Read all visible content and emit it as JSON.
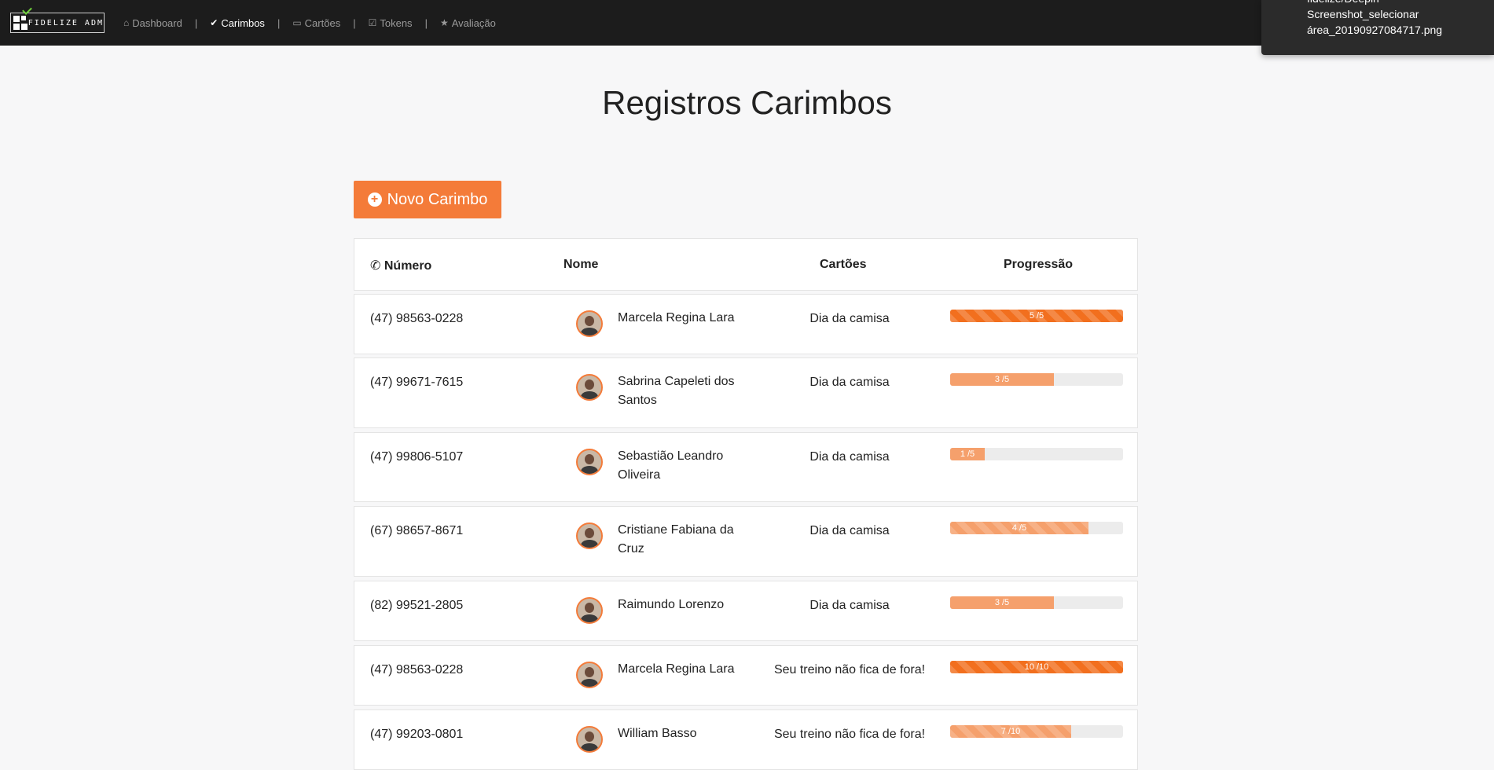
{
  "brand": {
    "text": "FIDELIZE ADM"
  },
  "nav": [
    {
      "label": "Dashboard",
      "icon": "home-icon",
      "glyph": "⌂",
      "active": false
    },
    {
      "label": "Carimbos",
      "icon": "check-circle-icon",
      "glyph": "✔",
      "active": true
    },
    {
      "label": "Cartões",
      "icon": "card-icon",
      "glyph": "▭",
      "active": false
    },
    {
      "label": "Tokens",
      "icon": "calendar-check-icon",
      "glyph": "☑",
      "active": false
    },
    {
      "label": "Avaliação",
      "icon": "star-icon",
      "glyph": "★",
      "active": false
    }
  ],
  "nav_separator": "|",
  "notification": {
    "lines": [
      "fidelize/Deepin",
      "Screenshot_selecionar",
      "área_20190927084717.png"
    ]
  },
  "page_title": "Registros Carimbos",
  "new_button": {
    "label": "Novo Carimbo",
    "glyph": "+"
  },
  "table": {
    "headers": {
      "numero": "Número",
      "nome": "Nome",
      "cartoes": "Cartões",
      "progressao": "Progressão"
    },
    "phone_glyph": "✆",
    "rows": [
      {
        "numero": "(47) 98563-0228",
        "nome": "Marcela Regina Lara",
        "cartao": "Dia da camisa",
        "progress_label": "5 /5",
        "progress": 1.0,
        "style": "dark-striped"
      },
      {
        "numero": "(47) 99671-7615",
        "nome": "Sabrina Capeleti dos Santos",
        "cartao": "Dia da camisa",
        "progress_label": "3 /5",
        "progress": 0.6,
        "style": "light"
      },
      {
        "numero": "(47) 99806-5107",
        "nome": "Sebastião Leandro Oliveira",
        "cartao": "Dia da camisa",
        "progress_label": "1 /5",
        "progress": 0.2,
        "style": "light"
      },
      {
        "numero": "(67) 98657-8671",
        "nome": "Cristiane Fabiana da Cruz",
        "cartao": "Dia da camisa",
        "progress_label": "4 /5",
        "progress": 0.8,
        "style": "light-striped"
      },
      {
        "numero": "(82) 99521-2805",
        "nome": "Raimundo Lorenzo",
        "cartao": "Dia da camisa",
        "progress_label": "3 /5",
        "progress": 0.6,
        "style": "light"
      },
      {
        "numero": "(47) 98563-0228",
        "nome": "Marcela Regina Lara",
        "cartao": "Seu treino não fica de fora!",
        "progress_label": "10 /10",
        "progress": 1.0,
        "style": "dark-striped"
      },
      {
        "numero": "(47) 99203-0801",
        "nome": "William Basso",
        "cartao": "Seu treino não fica de fora!",
        "progress_label": "7 /10",
        "progress": 0.7,
        "style": "light-striped"
      }
    ]
  },
  "colors": {
    "accent": "#f47b39",
    "bar_dark": "#f26f1e",
    "bar_light": "#f5a06c",
    "navbar": "#1c1c1c"
  }
}
